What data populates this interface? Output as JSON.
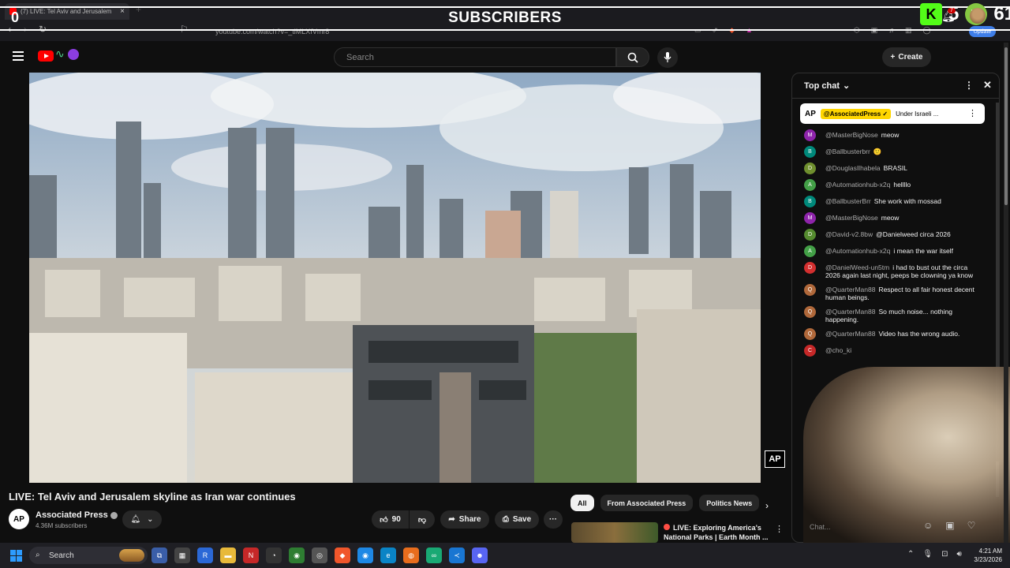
{
  "browser": {
    "tab_title": "(7) LIVE: Tel Aviv and Jerusalem",
    "tab_close": "×",
    "new_tab": "+",
    "url": "youtube.com/watch?v=_tlMLXfVmr8",
    "update_label": "Update"
  },
  "overlay": {
    "title": "SUBSCRIBERS",
    "left_count": "0",
    "kick_count": "5",
    "rumble_count": "61",
    "kick_icon": "K",
    "rumble_icon": "▶"
  },
  "youtube": {
    "search_placeholder": "Search",
    "create_label": "Create",
    "notification_count": "7"
  },
  "video": {
    "title": "LIVE: Tel Aviv and Jerusalem skyline as Iran war continues",
    "watermark": "AP",
    "channel_avatar": "AP",
    "channel_name": "Associated Press",
    "subscribers": "4.36M subscribers",
    "like_count": "90",
    "share_label": "Share",
    "save_label": "Save"
  },
  "recommendations": {
    "chips": [
      "All",
      "From Associated Press",
      "Politics News"
    ],
    "next_title": "LIVE: Exploring America's National Parks | Earth Month ..."
  },
  "chat": {
    "mode_label": "Top chat",
    "pinned_logo": "AP",
    "pinned_author": "@AssociatedPress ✓",
    "pinned_text": "Under Israeli ...",
    "input_placeholder": "Chat...",
    "messages": [
      {
        "author": "@MasterBigNose",
        "text": "meow",
        "avatar": "M",
        "color": "#8e24aa"
      },
      {
        "author": "@Ballbusterbrr",
        "text": "🙂",
        "avatar": "B",
        "color": "#00897b"
      },
      {
        "author": "@DouglasIlhabela",
        "text": "BRASIL",
        "avatar": "D",
        "color": "#6f8f2e"
      },
      {
        "author": "@Automationhub-x2q",
        "text": "hellllo",
        "avatar": "A",
        "color": "#43a047"
      },
      {
        "author": "@BallbusterBrr",
        "text": "She work with mossad",
        "avatar": "B",
        "color": "#00897b"
      },
      {
        "author": "@MasterBigNose",
        "text": "meow",
        "avatar": "M",
        "color": "#8e24aa"
      },
      {
        "author": "@David-v2.8bw",
        "text": "@Danielweed circa 2026",
        "avatar": "D",
        "color": "#558b2f"
      },
      {
        "author": "@Automationhub-x2q",
        "text": "i mean the war itself",
        "avatar": "A",
        "color": "#43a047"
      },
      {
        "author": "@DanielWeed-un5tm",
        "text": "i had to bust out the circa 2026 again last night, peeps be clowning ya know",
        "avatar": "D",
        "color": "#d32f2f"
      },
      {
        "author": "@QuarterMan88",
        "text": "Respect to all fair honest decent human beings.",
        "avatar": "Q",
        "color": "#b0683a"
      },
      {
        "author": "@QuarterMan88",
        "text": "So much noise... nothing happening.",
        "avatar": "Q",
        "color": "#b0683a"
      },
      {
        "author": "@QuarterMan88",
        "text": "Video has the wrong audio.",
        "avatar": "Q",
        "color": "#b0683a"
      },
      {
        "author": "@cho_ki",
        "text": "",
        "avatar": "C",
        "color": "#c62828"
      }
    ]
  },
  "taskbar": {
    "search_label": "Search",
    "time": "4:21 AM",
    "date": "3/23/2026"
  }
}
